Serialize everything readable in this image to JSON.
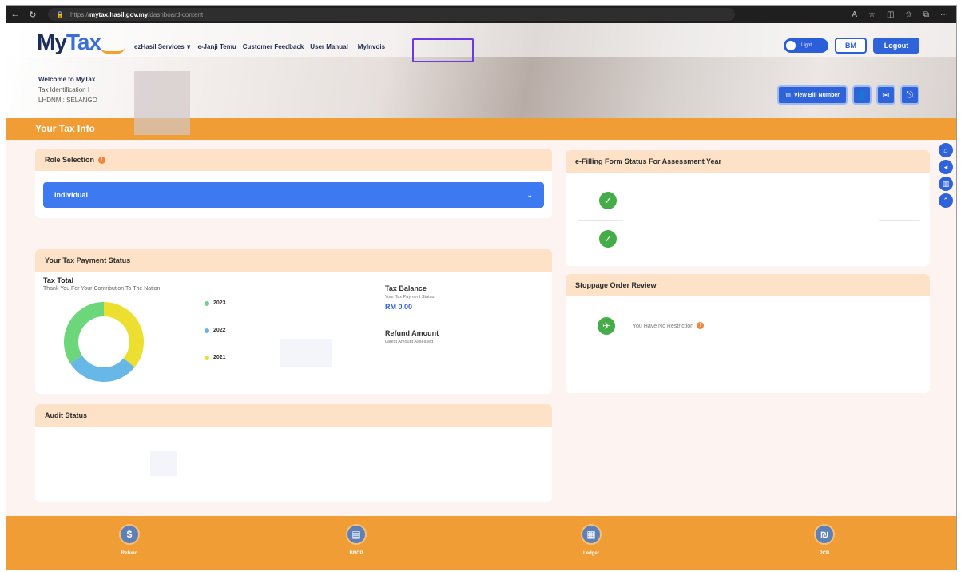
{
  "browser": {
    "url_prefix": "https://",
    "url_host": "mytax.hasil.gov.my",
    "url_path": "/dashboard-content"
  },
  "header": {
    "logo_my": "My",
    "logo_tax": "Tax",
    "menu": [
      "ezHasil Services ∨",
      "e-Janji Temu",
      "Customer Feedback",
      "User Manual",
      "MyInvois"
    ],
    "toggle_label": "Light",
    "lang_label": "BM",
    "logout_label": "Logout",
    "welcome_title": "Welcome to MyTax",
    "welcome_tin": "Tax Identification I",
    "welcome_branch": "LHDNM : SELANGO",
    "view_bill_label": "View Bill Number"
  },
  "section_title": "Your Tax Info",
  "role": {
    "title": "Role Selection",
    "selected": "Individual"
  },
  "payment": {
    "title": "Your Tax Payment Status",
    "tax_total": "Tax Total",
    "thanks": "Thank You For Your Contribution To The Nation",
    "balance_title": "Tax Balance",
    "balance_sub": "Your Tax Payment Status",
    "balance_value": "RM 0.00",
    "refund_title": "Refund Amount",
    "refund_sub": "Latest Amount Assessed"
  },
  "chart_data": {
    "type": "pie",
    "categories": [
      "2023",
      "2022",
      "2021"
    ],
    "values": [
      34,
      30,
      36
    ],
    "colors": [
      "#6cd67a",
      "#67b8e7",
      "#ecdf2f"
    ]
  },
  "audit": {
    "title": "Audit Status"
  },
  "efiling": {
    "title": "e-Filling Form Status For Assessment Year"
  },
  "stoppage": {
    "title": "Stoppage Order Review",
    "message": "You Have No Restriction"
  },
  "bottom_nav": [
    {
      "label": "Refund",
      "icon": "refund-icon"
    },
    {
      "label": "BNCP",
      "icon": "bncp-icon"
    },
    {
      "label": "Ledger",
      "icon": "ledger-icon"
    },
    {
      "label": "PCB",
      "icon": "pcb-icon"
    }
  ],
  "colors": {
    "orange": "#f19d35",
    "blue": "#2f63d9",
    "green": "#44ad47",
    "card_head": "#fde2c8"
  }
}
